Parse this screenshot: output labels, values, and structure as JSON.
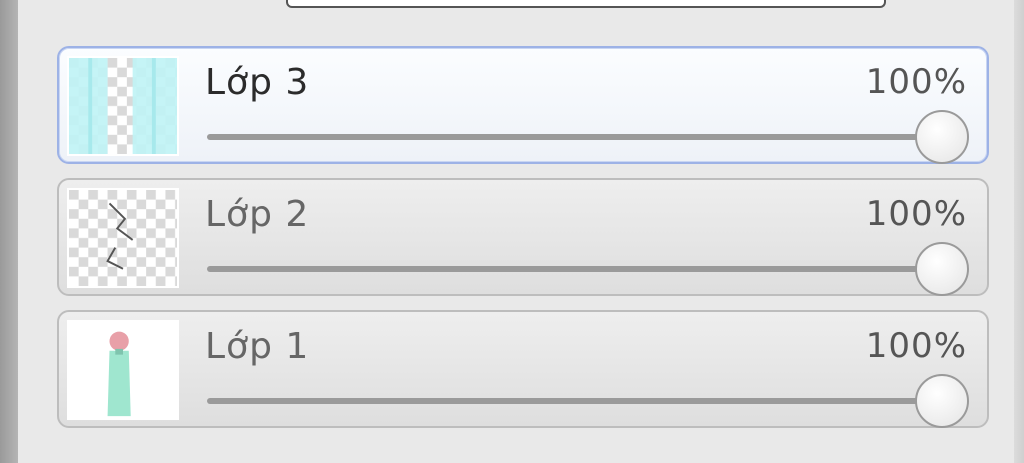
{
  "layers": [
    {
      "name": "Lớp 3",
      "opacity": "100%",
      "selected": true,
      "thumbnail": "cyan-checker-thumbnail"
    },
    {
      "name": "Lớp 2",
      "opacity": "100%",
      "selected": false,
      "thumbnail": "sketch-checker-thumbnail"
    },
    {
      "name": "Lớp 1",
      "opacity": "100%",
      "selected": false,
      "thumbnail": "figure-thumbnail"
    }
  ],
  "colors": {
    "selected_border": "#9db2e6",
    "checker_light": "#ffffff",
    "checker_dark": "#d9d9d9",
    "cyan": "#bff3f5",
    "figure_teal": "#9fe6cf",
    "figure_pink": "#e8a0a8"
  }
}
